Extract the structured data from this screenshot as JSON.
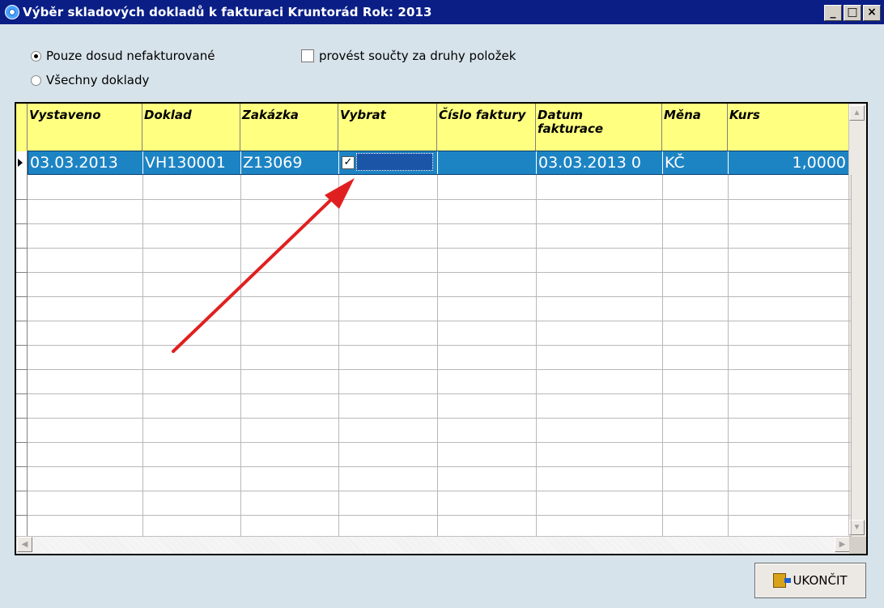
{
  "window": {
    "title": "Výběr skladových dokladů k fakturaci  Kruntorád  Rok: 2013",
    "buttons": [
      "_",
      "□",
      "×"
    ]
  },
  "filters": {
    "radio_unbilled_label": "Pouze dosud nefakturované",
    "radio_unbilled_selected": true,
    "radio_all_label": "Všechny doklady",
    "radio_all_selected": false,
    "checkbox_sums_label": "provést součty za druhy položek",
    "checkbox_sums_checked": false
  },
  "grid": {
    "columns": [
      "Vystaveno",
      "Doklad",
      "Zakázka",
      "Vybrat",
      "Číslo faktury",
      "Datum fakturace",
      "Měna",
      "Kurs"
    ],
    "rows": [
      {
        "vystaveno": "03.03.2013",
        "doklad": "VH130001",
        "zakazka": "Z13069",
        "vybrat": true,
        "cislo_faktury": "",
        "datum_fakturace": "03.03.2013 0",
        "mena": "KČ",
        "kurs": "1,0000"
      }
    ],
    "selected_row_color": "#1d84c4",
    "header_color": "#ffff80"
  },
  "annotation": {
    "arrow_color": "#e02020"
  },
  "footer": {
    "end_button_label": "UKONČIT",
    "end_button_icon": "exit-door-icon"
  }
}
